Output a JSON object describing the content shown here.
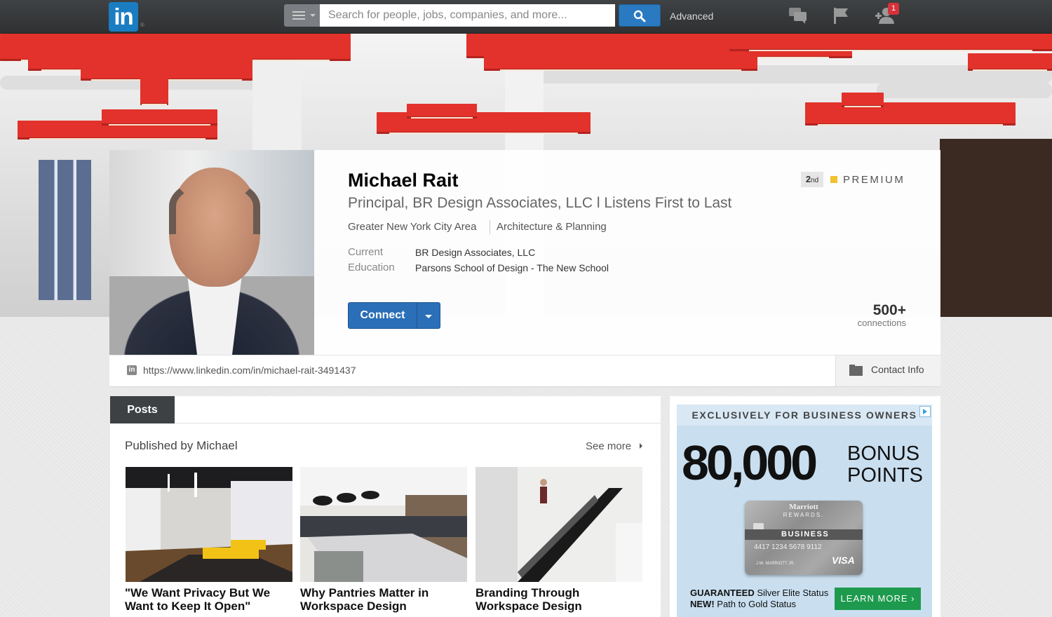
{
  "topbar": {
    "logo_text": "in",
    "logo_registered": "®",
    "search_placeholder": "Search for people, jobs, companies, and more...",
    "advanced_label": "Advanced",
    "notification_count": "1",
    "icons": [
      "menu-icon",
      "search-icon",
      "messages-icon",
      "flag-icon",
      "add-connection-icon"
    ]
  },
  "profile": {
    "name": "Michael Rait",
    "headline": "Principal, BR Design Associates, LLC l Listens First to Last",
    "location": "Greater New York City Area",
    "industry": "Architecture & Planning",
    "current_label": "Current",
    "current_value": "BR Design Associates, LLC",
    "education_label": "Education",
    "education_value": "Parsons School of Design - The New School",
    "degree": "2",
    "degree_suffix": "nd",
    "premium_label": "PREMIUM",
    "connect_label": "Connect",
    "connections_count": "500+",
    "connections_label": "connections",
    "public_url": "https://www.linkedin.com/in/michael-rait-3491437",
    "contact_info_label": "Contact Info"
  },
  "posts": {
    "tab_label": "Posts",
    "published_by": "Published by Michael",
    "see_more": "See more",
    "items": [
      {
        "title_line1": "\"We Want Privacy But We",
        "title_line2": "Want to Keep It Open\""
      },
      {
        "title_line1": "Why Pantries Matter in",
        "title_line2": "Workspace Design"
      },
      {
        "title_line1": "Branding Through",
        "title_line2": "Workspace Design"
      }
    ]
  },
  "ad": {
    "header": "EXCLUSIVELY FOR BUSINESS OWNERS",
    "big_number": "80,000",
    "bonus_line1": "BONUS",
    "bonus_line2": "POINTS",
    "card_brand": "Marriott",
    "card_rewards": "REWARDS.",
    "card_business": "BUSINESS",
    "card_number": "4417 1234 5678 9112",
    "card_holder": "J.W. MARRIOTT JR.",
    "card_network": "VISA",
    "guarantee_bold": "GUARANTEED",
    "guarantee_rest": " Silver Elite Status",
    "new_bold": "NEW!",
    "new_rest": " Path to Gold Status",
    "cta": "LEARN MORE ›"
  },
  "colors": {
    "brand_blue": "#1a7dc2",
    "connect_blue": "#2a6fb7",
    "premium_gold": "#f2c12e",
    "badge_red": "#d7313a",
    "cta_green": "#1d9a4d"
  }
}
